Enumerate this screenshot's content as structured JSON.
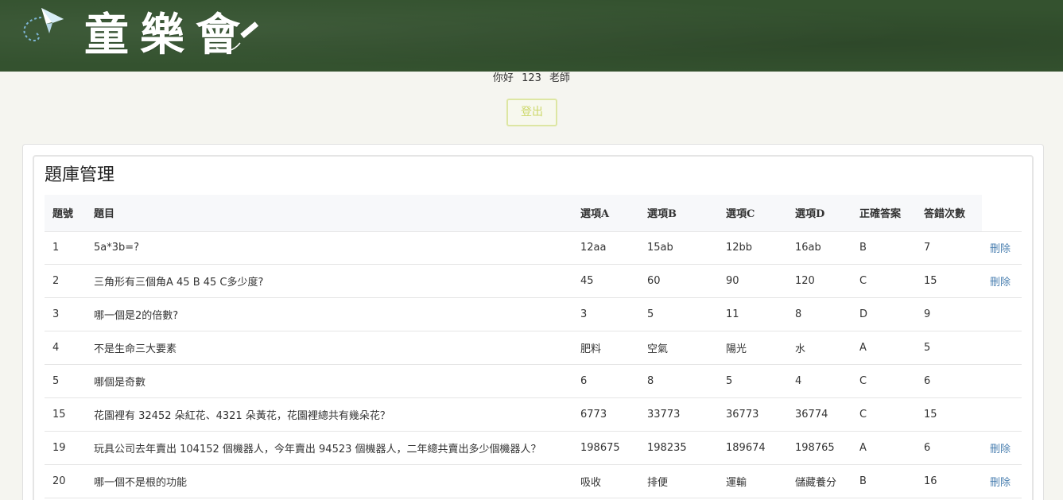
{
  "header": {
    "logo_text": "童樂會",
    "colors": {
      "banner": "#34522f"
    }
  },
  "user": {
    "greeting": "你好",
    "name": "123",
    "role": "老師",
    "logout_label": "登出"
  },
  "page": {
    "title": "題庫管理"
  },
  "table": {
    "headers": [
      "題號",
      "題目",
      "選項A",
      "選項B",
      "選項C",
      "選項D",
      "正確答案",
      "答錯次數"
    ],
    "delete_label": "刪除",
    "rows": [
      {
        "id": "1",
        "question": "5a*3b=?",
        "a": "12aa",
        "b": "15ab",
        "c": "12bb",
        "d": "16ab",
        "answer": "B",
        "wrong": "7",
        "delete": true
      },
      {
        "id": "2",
        "question": "三角形有三個角A 45 B 45 C多少度?",
        "a": "45",
        "b": "60",
        "c": "90",
        "d": "120",
        "answer": "C",
        "wrong": "15",
        "delete": true
      },
      {
        "id": "3",
        "question": "哪一個是2的倍數?",
        "a": "3",
        "b": "5",
        "c": "11",
        "d": "8",
        "answer": "D",
        "wrong": "9",
        "delete": false
      },
      {
        "id": "4",
        "question": "不是生命三大要素",
        "a": "肥料",
        "b": "空氣",
        "c": "陽光",
        "d": "水",
        "answer": "A",
        "wrong": "5",
        "delete": false
      },
      {
        "id": "5",
        "question": "哪個是奇數",
        "a": "6",
        "b": "8",
        "c": "5",
        "d": "4",
        "answer": "C",
        "wrong": "6",
        "delete": false
      },
      {
        "id": "15",
        "question": "花園裡有 32452 朵紅花、4321 朵黃花，花園裡總共有幾朵花？",
        "a": "6773",
        "b": "33773",
        "c": "36773",
        "d": "36774",
        "answer": "C",
        "wrong": "15",
        "delete": false
      },
      {
        "id": "19",
        "question": "玩具公司去年賣出 104152 個機器人，今年賣出 94523 個機器人，二年總共賣出多少個機器人？",
        "a": "198675",
        "b": "198235",
        "c": "189674",
        "d": "198765",
        "answer": "A",
        "wrong": "6",
        "delete": true
      },
      {
        "id": "20",
        "question": "哪一個不是根的功能",
        "a": "吸收",
        "b": "排便",
        "c": "運輸",
        "d": "儲藏養分",
        "answer": "B",
        "wrong": "16",
        "delete": true
      }
    ]
  }
}
